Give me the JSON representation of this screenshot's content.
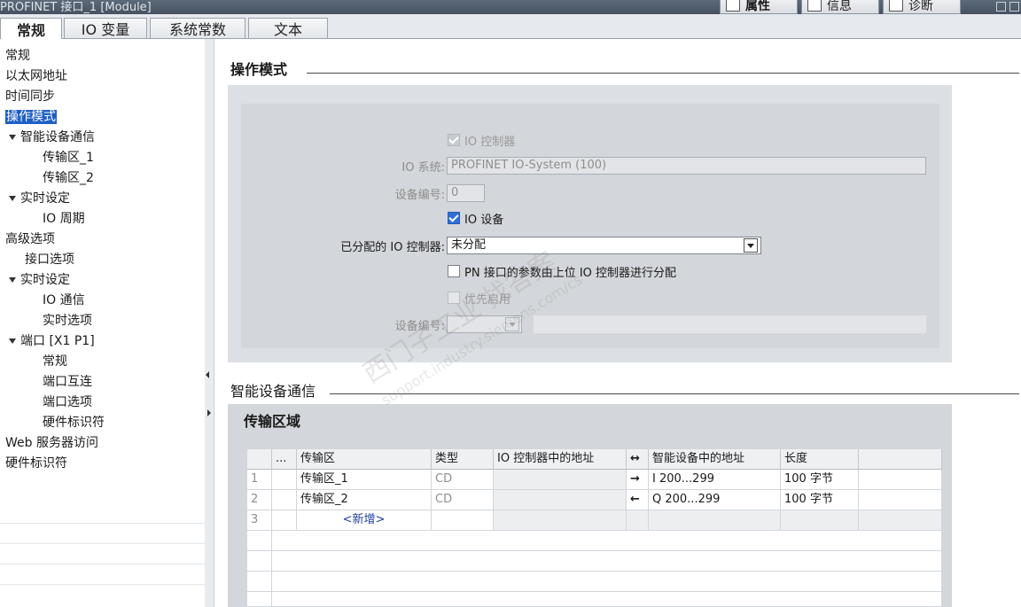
{
  "window": {
    "title": "PROFINET 接口_1 [Module]",
    "right_tabs": [
      {
        "label": "属性"
      },
      {
        "label": "信息"
      },
      {
        "label": "诊断"
      }
    ]
  },
  "tabs": [
    {
      "label": "常规",
      "active": true
    },
    {
      "label": "IO 变量",
      "active": false
    },
    {
      "label": "系统常数",
      "active": false
    },
    {
      "label": "文本",
      "active": false
    }
  ],
  "nav": [
    {
      "label": "常规",
      "indent": 0,
      "expander": false,
      "selected": false
    },
    {
      "label": "以太网地址",
      "indent": 0,
      "expander": false,
      "selected": false
    },
    {
      "label": "时间同步",
      "indent": 0,
      "expander": false,
      "selected": false
    },
    {
      "label": "操作模式",
      "indent": 0,
      "expander": false,
      "selected": true
    },
    {
      "label": "智能设备通信",
      "indent": 0,
      "expander": true,
      "selected": false
    },
    {
      "label": "传输区_1",
      "indent": 2,
      "expander": false,
      "selected": false
    },
    {
      "label": "传输区_2",
      "indent": 2,
      "expander": false,
      "selected": false
    },
    {
      "label": "实时设定",
      "indent": 0,
      "expander": true,
      "selected": false
    },
    {
      "label": "IO 周期",
      "indent": 2,
      "expander": false,
      "selected": false
    },
    {
      "label": "高级选项",
      "indent": 0,
      "expander": false,
      "selected": false
    },
    {
      "label": "接口选项",
      "indent": 1,
      "expander": false,
      "selected": false
    },
    {
      "label": "实时设定",
      "indent": 0,
      "expander": true,
      "selected": false
    },
    {
      "label": "IO 通信",
      "indent": 2,
      "expander": false,
      "selected": false
    },
    {
      "label": "实时选项",
      "indent": 2,
      "expander": false,
      "selected": false
    },
    {
      "label": "端口 [X1 P1]",
      "indent": 0,
      "expander": true,
      "selected": false
    },
    {
      "label": "常规",
      "indent": 2,
      "expander": false,
      "selected": false
    },
    {
      "label": "端口互连",
      "indent": 2,
      "expander": false,
      "selected": false
    },
    {
      "label": "端口选项",
      "indent": 2,
      "expander": false,
      "selected": false
    },
    {
      "label": "硬件标识符",
      "indent": 2,
      "expander": false,
      "selected": false
    },
    {
      "label": "Web 服务器访问",
      "indent": 0,
      "expander": false,
      "selected": false
    },
    {
      "label": "硬件标识符",
      "indent": 0,
      "expander": false,
      "selected": false
    }
  ],
  "section_mode": {
    "title": "操作模式",
    "io_controller_label": "IO 控制器",
    "io_controller_checked": true,
    "io_system_label": "IO 系统:",
    "io_system_value": "PROFINET IO-System (100)",
    "device_number_label": "设备编号:",
    "device_number_value": "0",
    "io_device_label": "IO 设备",
    "io_device_checked": true,
    "assigned_controller_label": "已分配的 IO 控制器:",
    "assigned_controller_value": "未分配",
    "pn_params_label": "PN 接口的参数由上位 IO 控制器进行分配",
    "pn_params_checked": false,
    "prioritized_startup_label": "优先启用",
    "prioritized_startup_checked": false,
    "device_number2_label": "设备编号:",
    "device_number2_value": ""
  },
  "section_idevice": {
    "title": "智能设备通信",
    "subtitle": "传输区域"
  },
  "transfer_table": {
    "columns": [
      "...",
      "传输区",
      "类型",
      "IO 控制器中的地址",
      "↔",
      "智能设备中的地址",
      "长度",
      ""
    ],
    "rows": [
      {
        "no": "1",
        "name": "传输区_1",
        "type": "CD",
        "ctrl_addr": "",
        "dir": "→",
        "dev_addr": "I 200...299",
        "length": "100 字节"
      },
      {
        "no": "2",
        "name": "传输区_2",
        "type": "CD",
        "ctrl_addr": "",
        "dir": "←",
        "dev_addr": "Q 200...299",
        "length": "100 字节"
      }
    ],
    "add_row_no": "3",
    "add_row_label": "<新增>"
  },
  "watermark": {
    "line1": "西门子工业 找答案",
    "line2": "support.industry.siemens.com/cs"
  },
  "colors": {
    "selection": "#1f5fc6",
    "checkbox": "#2f6fd6",
    "panel": "#d3d6da"
  }
}
